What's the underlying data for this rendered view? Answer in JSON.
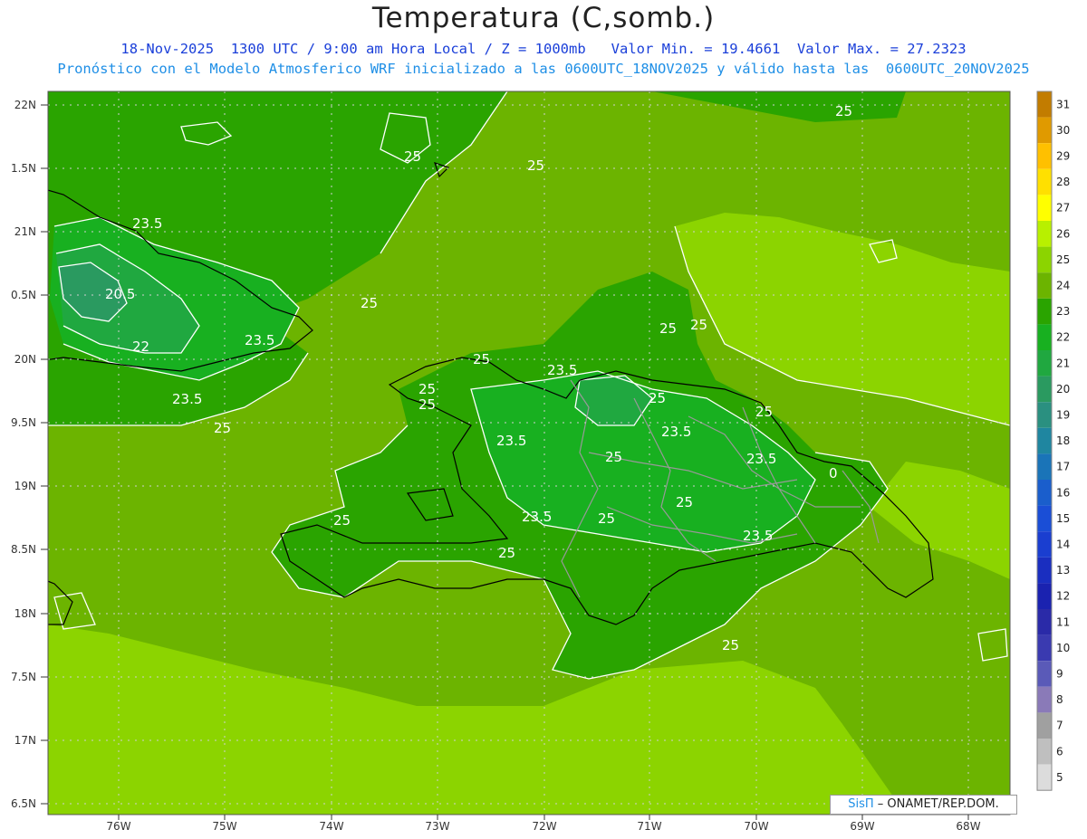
{
  "header": {
    "title": "Temperatura (C,somb.)",
    "line1": "18-Nov-2025  1300 UTC / 9:00 am Hora Local / Z = 1000mb   Valor Min. = 19.4661  Valor Max. = 27.2323",
    "line2": "Pronóstico con el Modelo Atmosferico WRF inicializado a las 0600UTC_18NOV2025 y válido hasta las  0600UTC_20NOV2025"
  },
  "axes": {
    "lat_labels": [
      "22N",
      "1.5N",
      "21N",
      "0.5N",
      "20N",
      "9.5N",
      "19N",
      "8.5N",
      "18N",
      "7.5N",
      "17N",
      "6.5N"
    ],
    "lon_labels": [
      "76W",
      "75W",
      "74W",
      "73W",
      "72W",
      "71W",
      "70W",
      "69W",
      "68W"
    ]
  },
  "contour_labels": [
    "25",
    "25",
    "25",
    "23.5",
    "20.5",
    "22",
    "23.5",
    "3.5",
    "23.5",
    "25",
    "25",
    "25",
    "23.5",
    "25",
    "25",
    "23.5",
    "23.5",
    "25",
    "25",
    "23.5",
    "25",
    "23.5",
    "25",
    "25",
    "23.5",
    "25",
    "25",
    "25",
    "25",
    "25",
    "0"
  ],
  "colorbar": {
    "levels": [
      "31",
      "30",
      "29",
      "28",
      "27",
      "26",
      "25",
      "24",
      "23",
      "22",
      "21",
      "20",
      "19",
      "18",
      "17",
      "16",
      "15",
      "14",
      "13",
      "12",
      "11",
      "10",
      "9",
      "8",
      "7",
      "6",
      "5"
    ],
    "colors": [
      "#c27c00",
      "#e09a00",
      "#ffc000",
      "#ffe000",
      "#ffff00",
      "#b8f000",
      "#8cd400",
      "#6cb400",
      "#2aa400",
      "#18b020",
      "#20a840",
      "#2a9a60",
      "#2a9080",
      "#1f86a0",
      "#1a74b8",
      "#1a5ecc",
      "#1a4ed6",
      "#1a3ed0",
      "#1a2ec0",
      "#1a22b0",
      "#2a2aa8",
      "#3a3ab0",
      "#5a5ab8",
      "#8a7ab8",
      "#a0a0a0",
      "#bfbfbf",
      "#dcdcdc"
    ]
  },
  "map_colors": {
    "sea_warm": "#8cd400",
    "level_25": "#6cb400",
    "level_24": "#2aa400",
    "level_23": "#18b020",
    "level_22": "#20a840",
    "level_21": "#2a9a60",
    "coast": "#000000",
    "border": "#999999"
  },
  "credit": {
    "brand": "SisΠ",
    "text": " – ONAMET/REP.DOM."
  }
}
